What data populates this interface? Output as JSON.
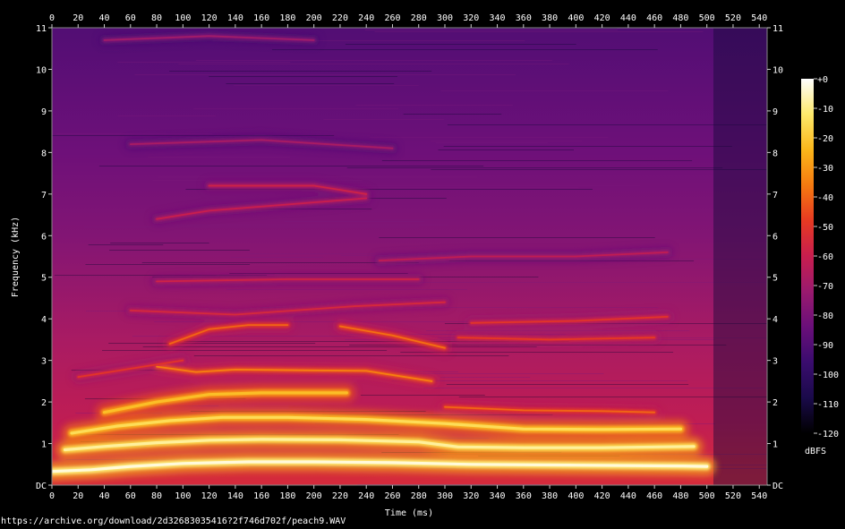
{
  "chart_data": {
    "type": "heatmap",
    "xlabel": "Time (ms)",
    "ylabel": "Frequency (kHz)",
    "x_ticks": [
      0,
      20,
      40,
      60,
      80,
      100,
      120,
      140,
      160,
      180,
      200,
      220,
      240,
      260,
      280,
      300,
      320,
      340,
      360,
      380,
      400,
      420,
      440,
      460,
      480,
      500,
      520,
      540
    ],
    "x_tick_labels": [
      "0",
      "20",
      "40",
      "60",
      "80",
      "100",
      "120",
      "140",
      "160",
      "180",
      "200",
      "220",
      "240",
      "260",
      "280",
      "300",
      "320",
      "340",
      "360",
      "380",
      "400",
      "420",
      "440",
      "460",
      "480",
      "500",
      "520",
      "540"
    ],
    "xlim": [
      0,
      546
    ],
    "y_ticks": [
      0,
      1,
      2,
      3,
      4,
      5,
      6,
      7,
      8,
      9,
      10,
      11
    ],
    "y_tick_labels": [
      "DC",
      "1",
      "2",
      "3",
      "4",
      "5",
      "6",
      "7",
      "8",
      "9",
      "10",
      "11"
    ],
    "ylim": [
      0,
      11
    ],
    "colorbar": {
      "label": "dBFS",
      "range": [
        -120,
        0
      ],
      "ticks": [
        0,
        -10,
        -20,
        -30,
        -40,
        -50,
        -60,
        -70,
        -80,
        -90,
        -100,
        -110,
        -120
      ],
      "tick_labels": [
        "+0",
        "-10",
        "-20",
        "-30",
        "-40",
        "-50",
        "-60",
        "-70",
        "-80",
        "-90",
        "-100",
        "-110",
        "-120"
      ],
      "colormap": [
        "#000000",
        "#1a0a4a",
        "#3a0c6e",
        "#6a0f7a",
        "#9a1a6e",
        "#c81e4e",
        "#e63a22",
        "#f57a10",
        "#fbb61a",
        "#fde96b",
        "#ffffff"
      ]
    },
    "background_level_db": [
      {
        "freq_khz": 0.2,
        "db": -55
      },
      {
        "freq_khz": 1.5,
        "db": -62
      },
      {
        "freq_khz": 3.5,
        "db": -68
      },
      {
        "freq_khz": 6,
        "db": -78
      },
      {
        "freq_khz": 8,
        "db": -83
      },
      {
        "freq_khz": 11,
        "db": -90
      }
    ],
    "formant_tracks": [
      {
        "points": [
          [
            0,
            0.33
          ],
          [
            30,
            0.37
          ],
          [
            60,
            0.45
          ],
          [
            100,
            0.52
          ],
          [
            150,
            0.56
          ],
          [
            200,
            0.56
          ],
          [
            260,
            0.54
          ],
          [
            320,
            0.5
          ],
          [
            400,
            0.48
          ],
          [
            480,
            0.46
          ],
          [
            500,
            0.45
          ]
        ],
        "db": -3
      },
      {
        "points": [
          [
            10,
            0.85
          ],
          [
            40,
            0.93
          ],
          [
            80,
            1.02
          ],
          [
            120,
            1.08
          ],
          [
            160,
            1.1
          ],
          [
            220,
            1.09
          ],
          [
            280,
            1.04
          ],
          [
            310,
            0.92
          ],
          [
            360,
            0.9
          ],
          [
            420,
            0.9
          ],
          [
            490,
            0.93
          ]
        ],
        "db": -8
      },
      {
        "points": [
          [
            15,
            1.25
          ],
          [
            50,
            1.42
          ],
          [
            90,
            1.55
          ],
          [
            130,
            1.63
          ],
          [
            180,
            1.63
          ],
          [
            240,
            1.58
          ],
          [
            300,
            1.48
          ],
          [
            360,
            1.35
          ],
          [
            420,
            1.34
          ],
          [
            480,
            1.35
          ]
        ],
        "db": -15
      },
      {
        "points": [
          [
            40,
            1.75
          ],
          [
            80,
            2.0
          ],
          [
            120,
            2.18
          ],
          [
            160,
            2.22
          ],
          [
            200,
            2.22
          ],
          [
            225,
            2.22
          ]
        ],
        "db": -22
      },
      {
        "points": [
          [
            300,
            1.88
          ],
          [
            360,
            1.8
          ],
          [
            420,
            1.78
          ],
          [
            460,
            1.75
          ]
        ],
        "db": -40
      },
      {
        "points": [
          [
            80,
            2.85
          ],
          [
            110,
            2.72
          ],
          [
            140,
            2.78
          ],
          [
            200,
            2.76
          ],
          [
            240,
            2.75
          ],
          [
            290,
            2.5
          ]
        ],
        "db": -35
      },
      {
        "points": [
          [
            90,
            3.4
          ],
          [
            120,
            3.75
          ],
          [
            150,
            3.85
          ],
          [
            180,
            3.85
          ]
        ],
        "db": -40
      },
      {
        "points": [
          [
            220,
            3.82
          ],
          [
            260,
            3.6
          ],
          [
            300,
            3.3
          ]
        ],
        "db": -38
      },
      {
        "points": [
          [
            310,
            3.55
          ],
          [
            380,
            3.5
          ],
          [
            460,
            3.55
          ]
        ],
        "db": -48
      },
      {
        "points": [
          [
            320,
            3.9
          ],
          [
            400,
            3.95
          ],
          [
            470,
            4.05
          ]
        ],
        "db": -50
      },
      {
        "points": [
          [
            60,
            4.2
          ],
          [
            140,
            4.1
          ],
          [
            230,
            4.3
          ],
          [
            300,
            4.4
          ]
        ],
        "db": -55
      },
      {
        "points": [
          [
            80,
            4.9
          ],
          [
            180,
            4.95
          ],
          [
            280,
            4.95
          ]
        ],
        "db": -58
      },
      {
        "points": [
          [
            80,
            6.4
          ],
          [
            120,
            6.6
          ],
          [
            200,
            6.8
          ],
          [
            240,
            6.9
          ]
        ],
        "db": -60
      },
      {
        "points": [
          [
            120,
            7.2
          ],
          [
            200,
            7.2
          ],
          [
            240,
            7.0
          ]
        ],
        "db": -58
      },
      {
        "points": [
          [
            250,
            5.4
          ],
          [
            320,
            5.5
          ],
          [
            400,
            5.5
          ],
          [
            470,
            5.6
          ]
        ],
        "db": -62
      },
      {
        "points": [
          [
            20,
            2.6
          ],
          [
            60,
            2.8
          ],
          [
            100,
            3.0
          ]
        ],
        "db": -50
      },
      {
        "points": [
          [
            60,
            8.2
          ],
          [
            160,
            8.3
          ],
          [
            260,
            8.1
          ]
        ],
        "db": -68
      },
      {
        "points": [
          [
            40,
            10.7
          ],
          [
            120,
            10.8
          ],
          [
            200,
            10.7
          ]
        ],
        "db": -70
      }
    ]
  },
  "source_url": "https://archive.org/download/2d32683035416?2f746d702f/peach9.WAV"
}
